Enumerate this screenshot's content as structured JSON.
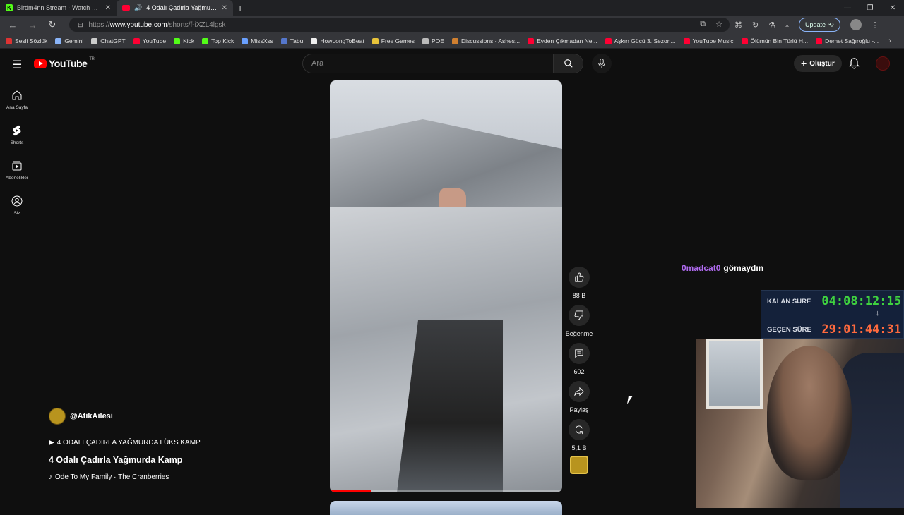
{
  "browser": {
    "tabs": [
      {
        "title": "Birdm4nn Stream - Watch Live on Kick",
        "icon": "kick-icon",
        "active": false
      },
      {
        "title": "4 Odalı Çadırla Yağmurda Kamp",
        "icon": "youtube-icon",
        "active": true
      }
    ],
    "url_prefix": "https://",
    "url_domain": "www.youtube.com",
    "url_path": "/shorts/f-iXZL4lgsk",
    "update_label": "Update",
    "bookmarks": [
      {
        "label": "Sesli Sözlük",
        "color": "#d33"
      },
      {
        "label": "Gemini",
        "color": "#8ab4f8"
      },
      {
        "label": "ChatGPT",
        "color": "#ccc"
      },
      {
        "label": "YouTube",
        "color": "#ff0033"
      },
      {
        "label": "Kick",
        "color": "#53fc18"
      },
      {
        "label": "Top Kick",
        "color": "#53fc18"
      },
      {
        "label": "MissXss",
        "color": "#6aa0ff"
      },
      {
        "label": "Tabu",
        "color": "#5577cc"
      },
      {
        "label": "HowLongToBeat",
        "color": "#eee"
      },
      {
        "label": "Free Games",
        "color": "#e8c33a"
      },
      {
        "label": "POE",
        "color": "#bbb"
      },
      {
        "label": "Discussions - Ashes...",
        "color": "#d08030"
      },
      {
        "label": "Evden Çıkmadan Ne...",
        "color": "#ff0033"
      },
      {
        "label": "Aşkın Gücü 3. Sezon...",
        "color": "#ff0033"
      },
      {
        "label": "YouTube Music",
        "color": "#ff0033"
      },
      {
        "label": "Ölümün Bin Türlü H...",
        "color": "#ff0033"
      },
      {
        "label": "Demet Sağıroğlu -...",
        "color": "#ff0033"
      }
    ]
  },
  "youtube": {
    "logo_text": "YouTube",
    "logo_region": "TR",
    "search_placeholder": "Ara",
    "create_label": "Oluştur",
    "sidebar": [
      {
        "label": "Ana Sayfa",
        "icon": "home-icon"
      },
      {
        "label": "Shorts",
        "icon": "shorts-icon"
      },
      {
        "label": "Abonelikler",
        "icon": "subscriptions-icon"
      },
      {
        "label": "Siz",
        "icon": "you-icon"
      }
    ],
    "short": {
      "channel": "@AtikAilesi",
      "playlist": "4 ODALI ÇADIRLA YAĞMURDA LÜKS KAMP",
      "title": "4 Odalı Çadırla Yağmurda Kamp",
      "sound": "Ode To My Family · The Cranberries",
      "progress": 0.18,
      "likes": "88 B",
      "dislike_label": "Beğenme",
      "comments": "602",
      "share_label": "Paylaş",
      "remix_count": "5,1 B"
    }
  },
  "overlay": {
    "chat_user": "0madcat0",
    "chat_message": "gömaydın",
    "remaining_label": "KALAN SÜRE",
    "remaining_value": "04:08:12:15",
    "elapsed_label": "GEÇEN SÜRE",
    "elapsed_value": "29:01:44:31",
    "remaining_color": "#3fd23f",
    "elapsed_color": "#ff6a3d"
  }
}
